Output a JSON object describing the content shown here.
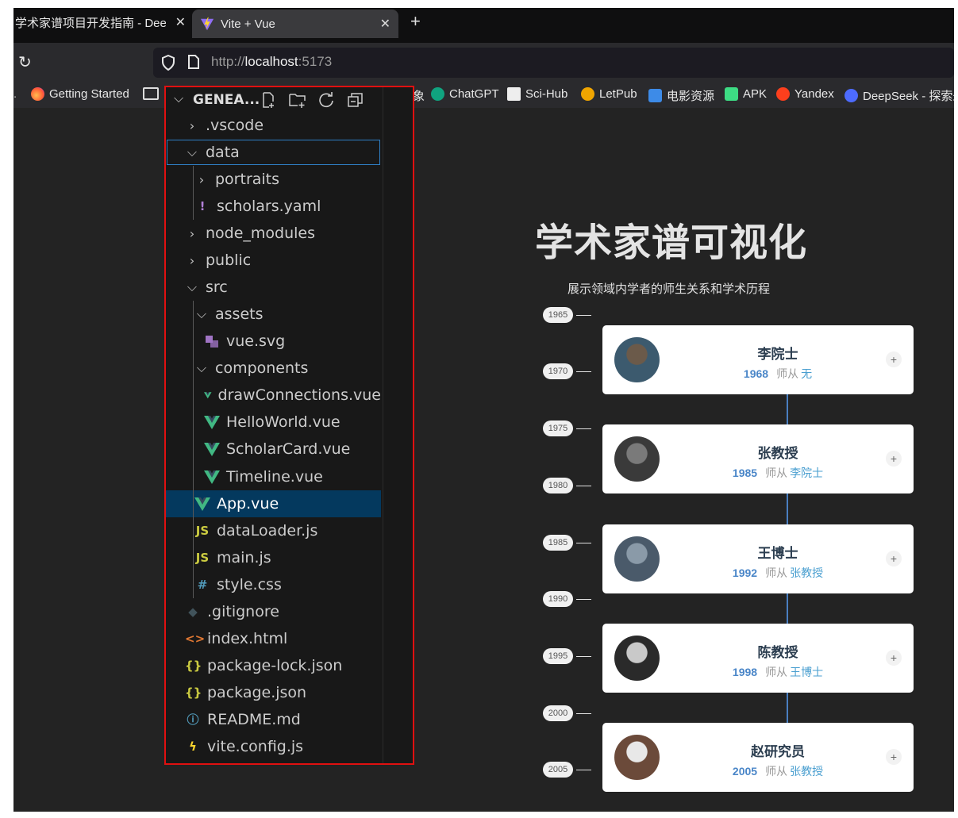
{
  "browser": {
    "tabs": [
      {
        "title": "学术家谱项目开发指南 - DeepS",
        "active": false
      },
      {
        "title": "Vite + Vue",
        "active": true
      }
    ],
    "close_glyph": "✕",
    "new_tab_glyph": "+",
    "reload_glyph": "↻",
    "url_scheme": "http://",
    "url_host": "localhost",
    "url_port": ":5173",
    "bookmarks": [
      {
        "label": "Getting Started",
        "icon": "firefox-icon"
      },
      {
        "label": "ChatGPT",
        "icon": "chatgpt-icon"
      },
      {
        "label": "Sci-Hub",
        "icon": "scihub-icon"
      },
      {
        "label": "LetPub",
        "icon": "letpub-icon"
      },
      {
        "label": "电影资源",
        "icon": "movie-icon"
      },
      {
        "label": "APK",
        "icon": "apk-icon"
      },
      {
        "label": "Yandex",
        "icon": "yandex-icon"
      },
      {
        "label": "DeepSeek - 探索未",
        "icon": "deepseek-icon"
      }
    ],
    "bookmark_partial": "象"
  },
  "app": {
    "title": "学术家谱可视化",
    "subtitle": "展示领域内学者的师生关系和学术历程",
    "timeline_years": [
      "1965",
      "1970",
      "1975",
      "1980",
      "1985",
      "1990",
      "1995",
      "2000",
      "2005"
    ],
    "mentor_label": "师从",
    "expand_glyph": "+",
    "scholars": [
      {
        "name": "李院士",
        "year": "1968",
        "mentor": "无"
      },
      {
        "name": "张教授",
        "year": "1985",
        "mentor": "李院士"
      },
      {
        "name": "王博士",
        "year": "1992",
        "mentor": "张教授"
      },
      {
        "name": "陈教授",
        "year": "1998",
        "mentor": "王博士"
      },
      {
        "name": "赵研究员",
        "year": "2005",
        "mentor": "张教授"
      }
    ]
  },
  "explorer": {
    "root_label": "GENEA...",
    "items": [
      {
        "label": ".vscode",
        "kind": "folder",
        "expanded": false,
        "depth": 0
      },
      {
        "label": "data",
        "kind": "folder",
        "expanded": true,
        "depth": 0,
        "focused": true
      },
      {
        "label": "portraits",
        "kind": "folder",
        "expanded": false,
        "depth": 1
      },
      {
        "label": "scholars.yaml",
        "kind": "yaml",
        "depth": 1,
        "icon_glyph": "!"
      },
      {
        "label": "node_modules",
        "kind": "folder",
        "expanded": false,
        "depth": 0
      },
      {
        "label": "public",
        "kind": "folder",
        "expanded": false,
        "depth": 0
      },
      {
        "label": "src",
        "kind": "folder",
        "expanded": true,
        "depth": 0
      },
      {
        "label": "assets",
        "kind": "folder",
        "expanded": true,
        "depth": 1
      },
      {
        "label": "vue.svg",
        "kind": "svg",
        "depth": 2
      },
      {
        "label": "components",
        "kind": "folder",
        "expanded": true,
        "depth": 1
      },
      {
        "label": "drawConnections.vue",
        "kind": "vue",
        "depth": 2
      },
      {
        "label": "HelloWorld.vue",
        "kind": "vue",
        "depth": 2
      },
      {
        "label": "ScholarCard.vue",
        "kind": "vue",
        "depth": 2
      },
      {
        "label": "Timeline.vue",
        "kind": "vue",
        "depth": 2
      },
      {
        "label": "App.vue",
        "kind": "vue",
        "depth": 1,
        "selected": true
      },
      {
        "label": "dataLoader.js",
        "kind": "js",
        "depth": 1,
        "icon_glyph": "JS"
      },
      {
        "label": "main.js",
        "kind": "js",
        "depth": 1,
        "icon_glyph": "JS"
      },
      {
        "label": "style.css",
        "kind": "css",
        "depth": 1,
        "icon_glyph": "#"
      },
      {
        "label": ".gitignore",
        "kind": "git",
        "depth": 0,
        "icon_glyph": "◆"
      },
      {
        "label": "index.html",
        "kind": "html",
        "depth": 0,
        "icon_glyph": "<>"
      },
      {
        "label": "package-lock.json",
        "kind": "json",
        "depth": 0,
        "icon_glyph": "{}"
      },
      {
        "label": "package.json",
        "kind": "json",
        "depth": 0,
        "icon_glyph": "{}"
      },
      {
        "label": "README.md",
        "kind": "info",
        "depth": 0,
        "icon_glyph": "ⓘ"
      },
      {
        "label": "vite.config.js",
        "kind": "vite",
        "depth": 0,
        "icon_glyph": "ϟ"
      }
    ]
  },
  "colors": {
    "accent_blue": "#4a86c8",
    "vue_green": "#41b883",
    "selection_bg": "#04395e",
    "focus_border": "#2f7fc6",
    "highlight_border": "#e01010"
  }
}
